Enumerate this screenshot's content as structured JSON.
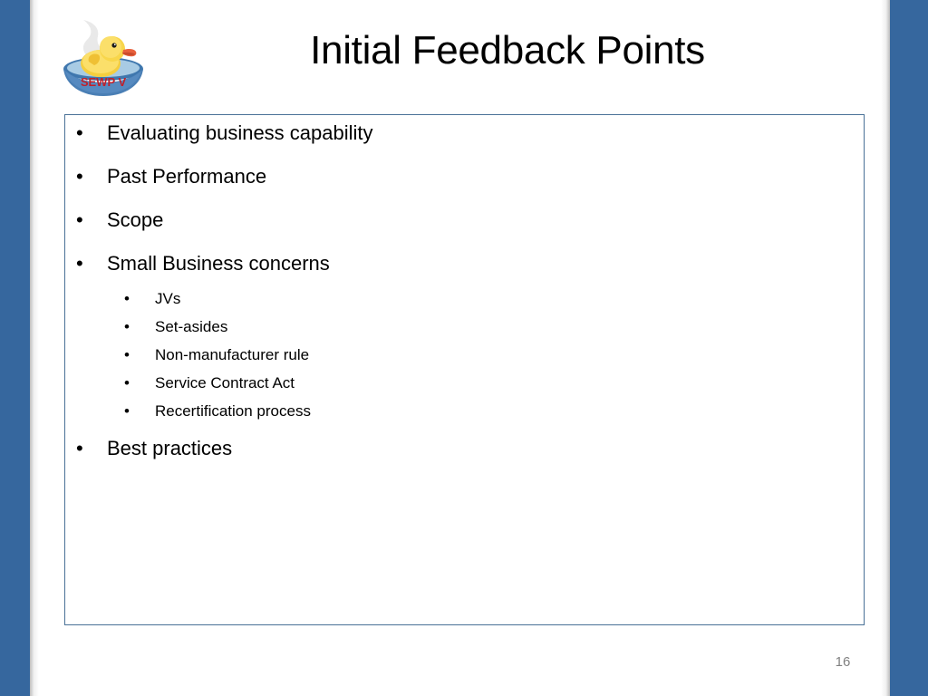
{
  "slide": {
    "title": "Initial Feedback Points",
    "page_number": "16",
    "accent_color": "#36679E",
    "box_border_color": "#4A7197",
    "text_color": "#000000",
    "page_number_color": "#808080"
  },
  "logo": {
    "name": "sewp-v-duck-logo",
    "text": "SEWP V",
    "text_color": "#C0202A",
    "duck_color": "#F5CE3E",
    "beak_color": "#E8603C",
    "bowl_color": "#4A7FB5",
    "water_color": "#A8CBE4",
    "steam_color": "#DCDCDC"
  },
  "content": {
    "bullets": [
      {
        "marker": "•",
        "text": "Evaluating business capability",
        "sub": []
      },
      {
        "marker": "•",
        "text": "Past Performance",
        "sub": []
      },
      {
        "marker": "•",
        "text": "Scope",
        "sub": []
      },
      {
        "marker": "•",
        "text": "Small Business concerns",
        "sub": [
          {
            "marker": "•",
            "text": "JVs"
          },
          {
            "marker": "•",
            "text": "Set-asides"
          },
          {
            "marker": "•",
            "text": "Non-manufacturer rule"
          },
          {
            "marker": "•",
            "text": "Service Contract Act"
          },
          {
            "marker": "•",
            "text": "Recertification process"
          }
        ]
      },
      {
        "marker": "•",
        "text": "Best practices",
        "sub": []
      }
    ]
  }
}
